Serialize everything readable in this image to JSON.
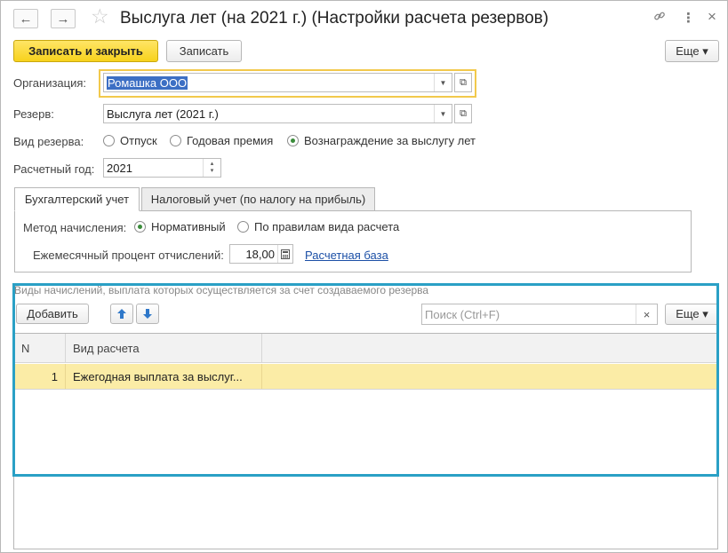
{
  "window": {
    "title": "Выслуга лет (на 2021 г.) (Настройки расчета резервов)",
    "nav_back": "←",
    "nav_forward": "→",
    "star": "☆",
    "link_icon": "🔗",
    "menu_icon": "⋮",
    "close_icon": "×"
  },
  "toolbar": {
    "save_close_label": "Записать и закрыть",
    "save_label": "Записать",
    "more_label": "Еще ▾"
  },
  "form": {
    "organization_label": "Организация:",
    "organization_value": "Ромашка ООО",
    "reserve_label": "Резерв:",
    "reserve_value": "Выслуга лет (2021 г.)",
    "reserve_kind_label": "Вид резерва:",
    "reserve_kind_options": [
      "Отпуск",
      "Годовая премия",
      "Вознаграждение за выслугу лет"
    ],
    "reserve_kind_selected": "Вознаграждение за выслугу лет",
    "calc_year_label": "Расчетный год:",
    "calc_year_value": "2021"
  },
  "tabs": [
    {
      "label": "Бухгалтерский учет",
      "active": true
    },
    {
      "label": "Налоговый учет (по налогу на прибыль)",
      "active": false
    }
  ],
  "accounting": {
    "method_label": "Метод начисления:",
    "method_options": [
      "Нормативный",
      "По правилам вида расчета"
    ],
    "method_selected": "Нормативный",
    "monthly_percent_label": "Ежемесячный процент отчислений:",
    "monthly_percent_value": "18,00",
    "calc_base_link": "Расчетная база"
  },
  "accruals": {
    "section_title": "Виды начислений, выплата которых осуществляется за счет создаваемого резерва",
    "add_label": "Добавить",
    "up_icon": "🡅",
    "down_icon": "🡇",
    "search_placeholder": "Поиск (Ctrl+F)",
    "clear_icon": "×",
    "more_label": "Еще ▾",
    "columns": [
      "N",
      "Вид расчета"
    ],
    "rows": [
      {
        "n": "1",
        "kind": "Ежегодная выплата за выслуг..."
      }
    ]
  },
  "colors": {
    "primary_button": "#f7d21c",
    "selected_row": "#fbeca6",
    "highlight_frame": "#2aa0c5",
    "link": "#1b4fa6"
  }
}
